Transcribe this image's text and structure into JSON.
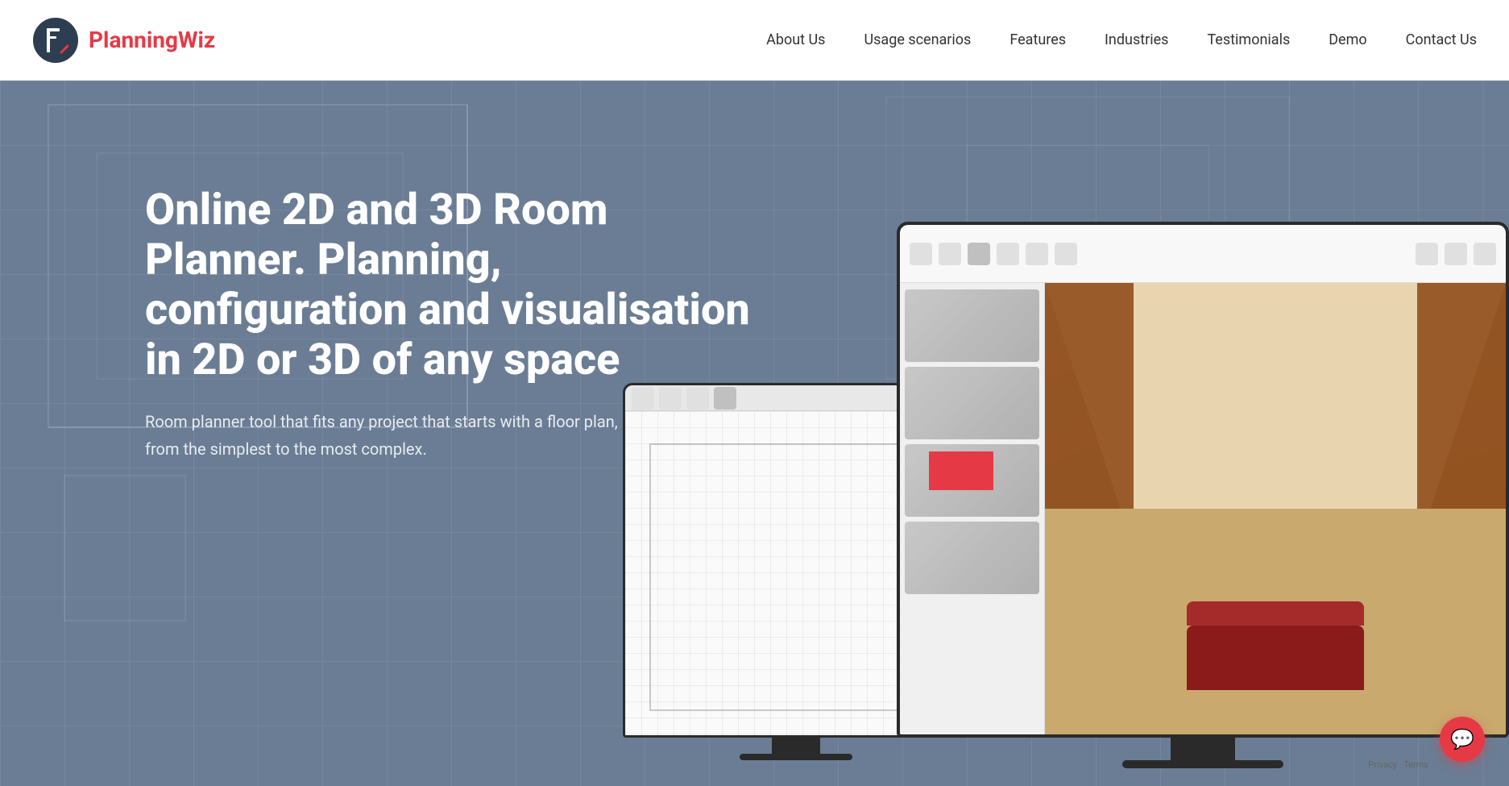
{
  "header": {
    "logo_text_plain": "Planning",
    "logo_text_bold": "Wiz",
    "nav": {
      "items": [
        {
          "label": "About Us",
          "id": "about-us"
        },
        {
          "label": "Usage scenarios",
          "id": "usage-scenarios"
        },
        {
          "label": "Features",
          "id": "features"
        },
        {
          "label": "Industries",
          "id": "industries"
        },
        {
          "label": "Testimonials",
          "id": "testimonials"
        },
        {
          "label": "Demo",
          "id": "demo"
        },
        {
          "label": "Contact Us",
          "id": "contact-us"
        }
      ]
    }
  },
  "hero": {
    "heading": "Online 2D and 3D Room Planner. Planning, configuration and visualisation in 2D or 3D of any space",
    "subtext_line1": "Room planner tool that fits any project that starts with a floor plan,",
    "subtext_line2": "from the simplest to the most complex."
  },
  "chat_button": {
    "aria_label": "Open chat"
  },
  "privacy_notice": {
    "text": "Privacy · Terms"
  }
}
